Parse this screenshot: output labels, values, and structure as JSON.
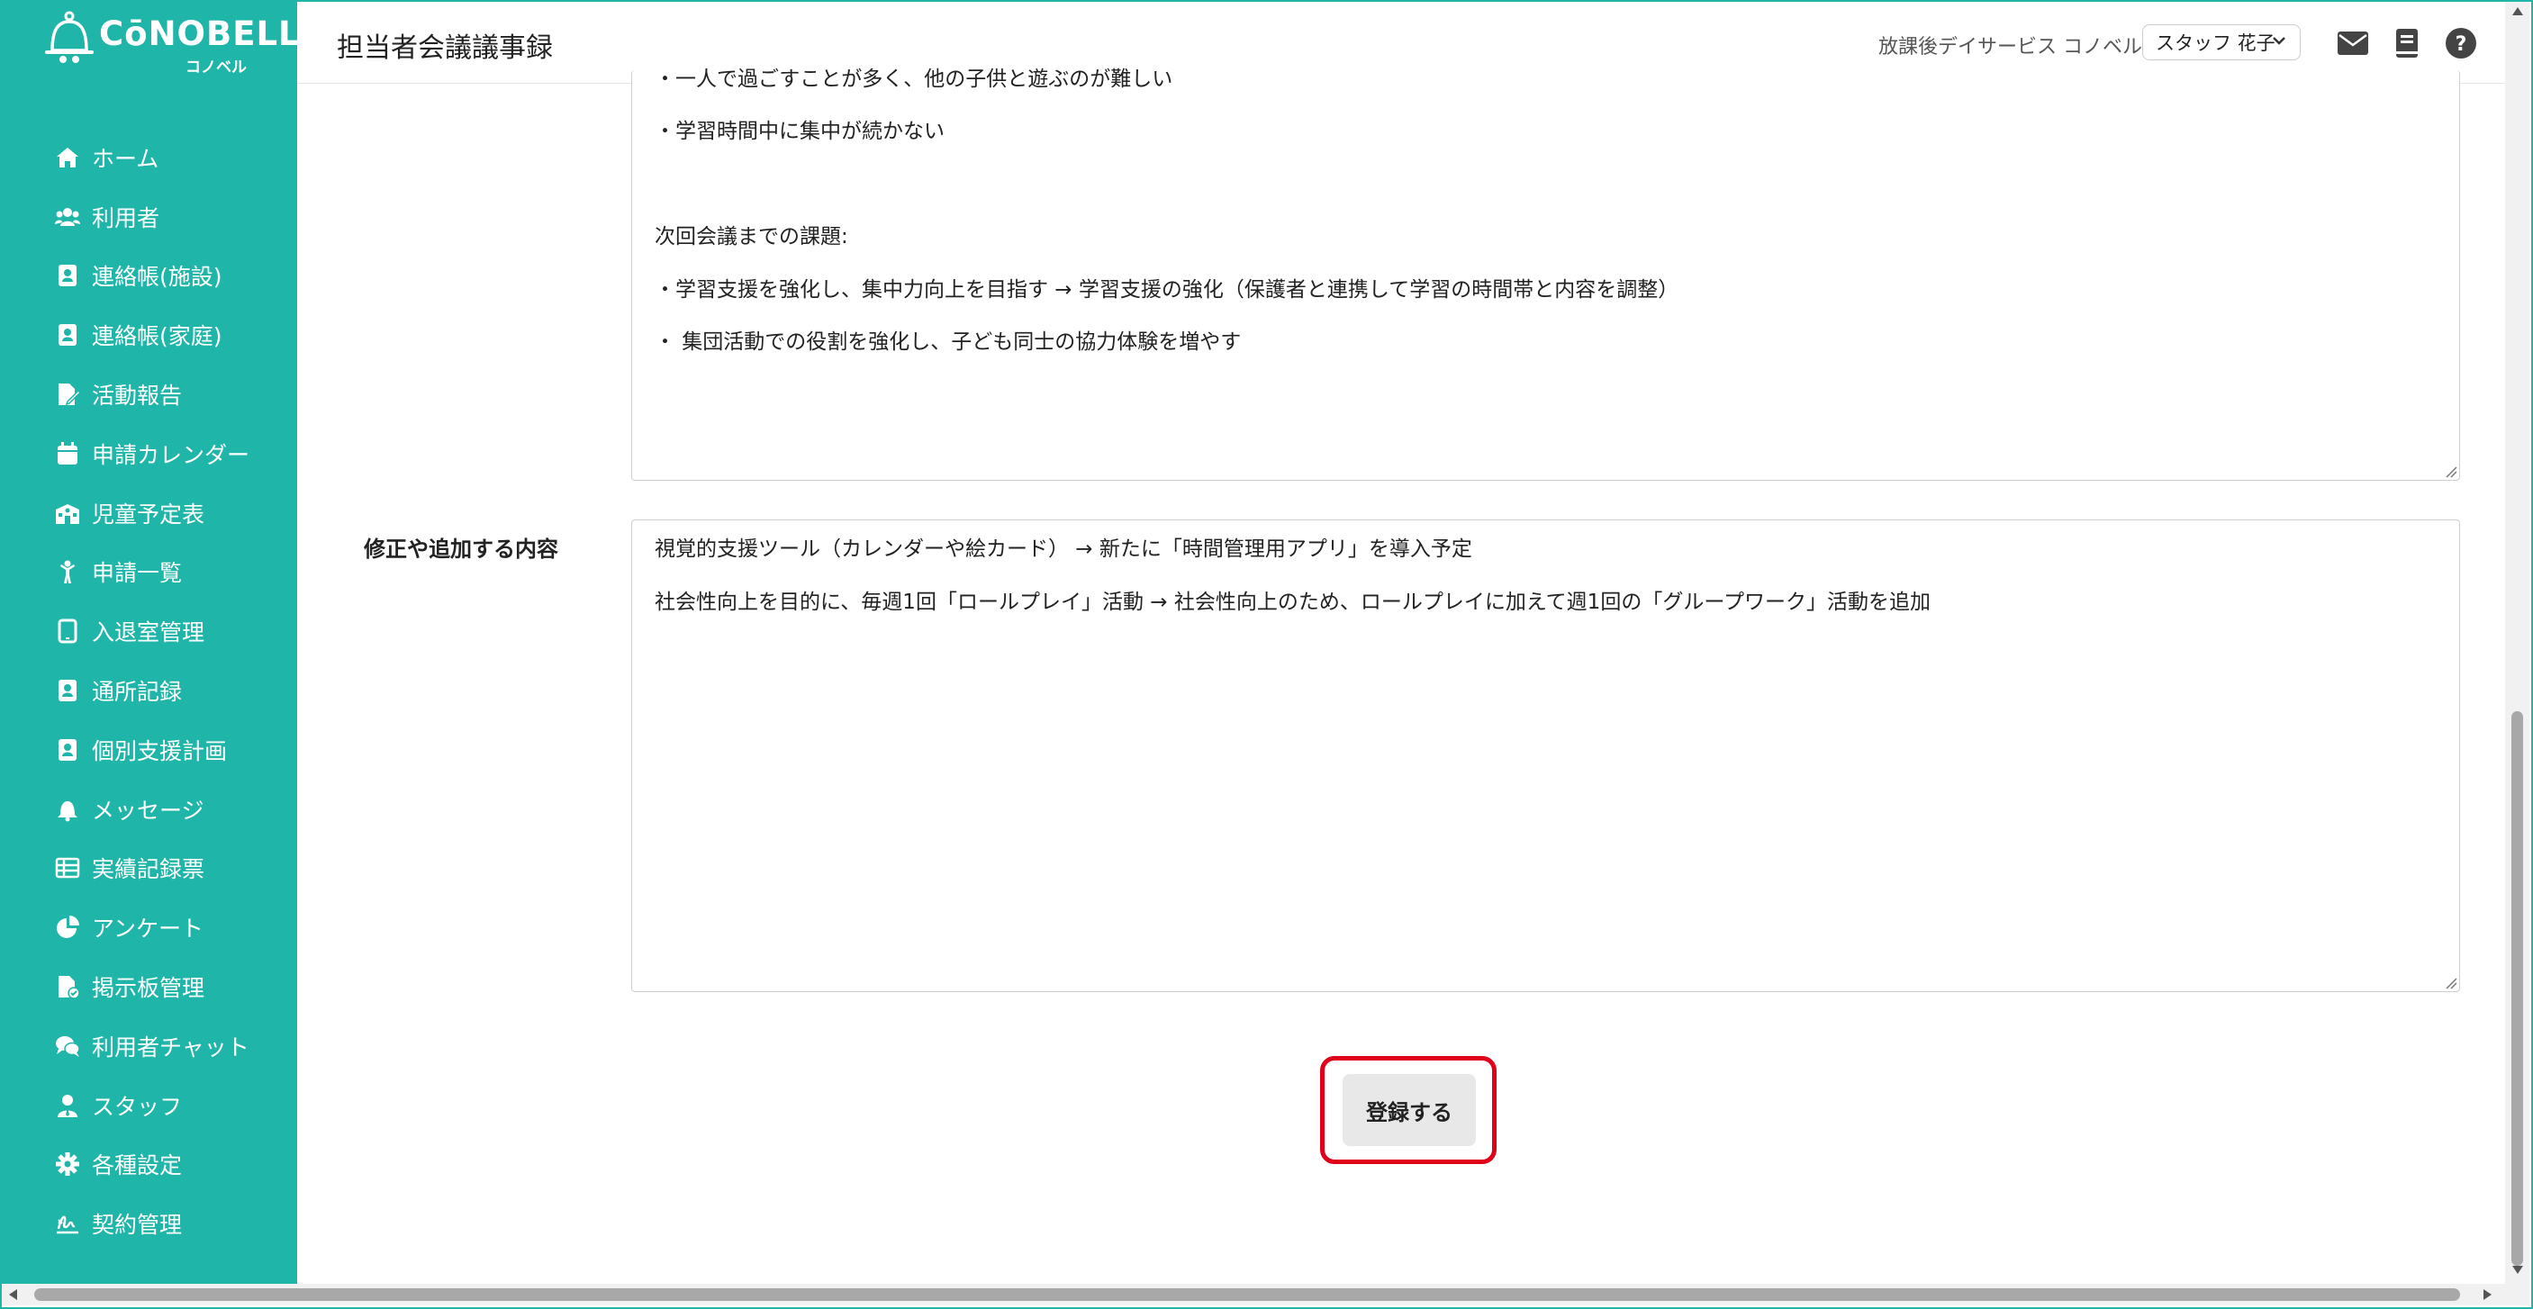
{
  "app": {
    "brand": "CōNOBELL",
    "brand_sub": "コノベル"
  },
  "sidebar": {
    "items": [
      {
        "label": "ホーム",
        "icon": "home-icon"
      },
      {
        "label": "利用者",
        "icon": "users-icon"
      },
      {
        "label": "連絡帳(施設)",
        "icon": "contact-card-icon"
      },
      {
        "label": "連絡帳(家庭)",
        "icon": "contact-card-icon"
      },
      {
        "label": "活動報告",
        "icon": "edit-file-icon"
      },
      {
        "label": "申請カレンダー",
        "icon": "calendar-icon"
      },
      {
        "label": "児童予定表",
        "icon": "school-icon"
      },
      {
        "label": "申請一覧",
        "icon": "child-icon"
      },
      {
        "label": "入退室管理",
        "icon": "tablet-icon"
      },
      {
        "label": "通所記録",
        "icon": "contact-card-icon"
      },
      {
        "label": "個別支援計画",
        "icon": "contact-card-icon"
      },
      {
        "label": "メッセージ",
        "icon": "bell-icon"
      },
      {
        "label": "実績記録票",
        "icon": "table-icon"
      },
      {
        "label": "アンケート",
        "icon": "pie-chart-icon"
      },
      {
        "label": "掲示板管理",
        "icon": "file-check-icon"
      },
      {
        "label": "利用者チャット",
        "icon": "chat-icon"
      },
      {
        "label": "スタッフ",
        "icon": "staff-icon"
      },
      {
        "label": "各種設定",
        "icon": "gear-icon"
      },
      {
        "label": "契約管理",
        "icon": "signature-icon"
      }
    ]
  },
  "header": {
    "title": "担当者会議議事録",
    "facility": "放課後デイサービス コノベル",
    "staff_selected": "スタッフ 花子"
  },
  "form": {
    "textarea1_lines": [
      "・一人で過ごすことが多く、他の子供と遊ぶのが難しい",
      "・学習時間中に集中が続かない",
      "",
      "次回会議までの課題:",
      "・学習支援を強化し、集中力向上を目指す → 学習支援の強化（保護者と連携して学習の時間帯と内容を調整）",
      "・ 集団活動での役割を強化し、子ども同士の協力体験を増やす"
    ],
    "modification_label": "修正や追加する内容",
    "textarea2_lines": [
      "視覚的支援ツール（カレンダーや絵カード） → 新たに「時間管理用アプリ」を導入予定",
      "社会性向上を目的に、毎週1回「ロールプレイ」活動 → 社会性向上のため、ロールプレイに加えて週1回の「グループワーク」活動を追加"
    ],
    "submit_label": "登録する"
  },
  "colors": {
    "sidebar": "#1fb5a8",
    "highlight": "#e0001a",
    "button": "#e8e8e8"
  }
}
